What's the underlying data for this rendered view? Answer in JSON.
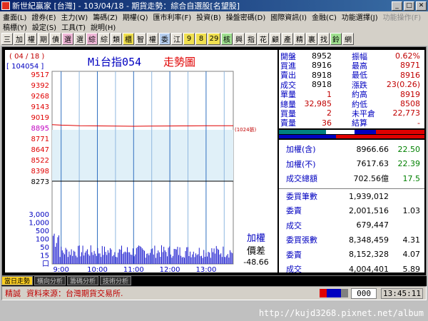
{
  "window": {
    "title": "新世紀贏家 [台灣] - 103/04/18 - 期貨走勢：綜合自選股[名望股]",
    "controls": [
      "_",
      "□",
      "✕"
    ]
  },
  "menu_row1": [
    "畫面(L)",
    "證券(E)",
    "主力(W)",
    "籌碼(Z)",
    "期權(Q)",
    "匯市利率(F)",
    "投資(B)",
    "操盤密碼(D)",
    "國際資訊(I)",
    "金融(C)",
    "功能選擇(J)"
  ],
  "menu_row1_disabled": [
    "功能操作(F)"
  ],
  "menu_row2": [
    "稿標(Y)",
    "設定(S)",
    "工具(T)",
    "說明(H)"
  ],
  "toolbar": [
    "三",
    "加",
    "權",
    "期",
    "債",
    "選",
    "選",
    "綜",
    "綜",
    "類",
    "櫃",
    "智",
    "權",
    "委",
    "江",
    "9",
    "8",
    "29",
    "核",
    "興",
    "指",
    "花",
    "顧",
    "產",
    "精",
    "裏",
    "找",
    "鈴",
    "網"
  ],
  "chart": {
    "date_label": "( 04 / 18 )",
    "code_label": "[ 104054 ]",
    "title_prefix": "Mi台指054",
    "title_suffix": "走勢圖",
    "price_ticks": [
      "9517",
      "9392",
      "9268",
      "9143",
      "9019",
      "8895",
      "8771",
      "8647",
      "8522",
      "8398",
      "8273"
    ],
    "volume_ticks": [
      "3,000",
      "1,000",
      "500",
      "100",
      "50",
      "15",
      "口"
    ],
    "time_ticks": [
      "9:00",
      "10:00",
      "11:00",
      "12:00",
      "13:00"
    ],
    "ref_label": "(1024張)",
    "side_label1": "加權",
    "side_label2": "價差",
    "side_value": "-48.66"
  },
  "chart_data": {
    "type": "line",
    "title": "Mi台指054 走勢圖",
    "ylim": [
      8273,
      9517
    ],
    "reference_price": 8895,
    "x_range": [
      "8:45",
      "13:45"
    ],
    "price_series": [
      {
        "t": "8:45",
        "v": 8930
      },
      {
        "t": "9:00",
        "v": 8925
      },
      {
        "t": "9:15",
        "v": 8922
      },
      {
        "t": "9:30",
        "v": 8918
      },
      {
        "t": "10:00",
        "v": 8916
      },
      {
        "t": "10:30",
        "v": 8914
      },
      {
        "t": "11:00",
        "v": 8912
      },
      {
        "t": "11:30",
        "v": 8913
      },
      {
        "t": "12:00",
        "v": 8915
      },
      {
        "t": "12:30",
        "v": 8916
      },
      {
        "t": "13:00",
        "v": 8917
      },
      {
        "t": "13:45",
        "v": 8918
      }
    ],
    "volume_note": "per-minute volume bars, mostly 100–500 口"
  },
  "quote": {
    "rows": [
      {
        "l1": "開盤",
        "v1": "8952",
        "l2": "振幅",
        "v2": "0.62%"
      },
      {
        "l1": "買進",
        "v1": "8916",
        "l2": "最高",
        "v2": "8971"
      },
      {
        "l1": "賣出",
        "v1": "8918",
        "l2": "最低",
        "v2": "8916"
      },
      {
        "l1": "成交",
        "v1": "8918",
        "l2": "漲跌",
        "v2": "23(0.26)"
      },
      {
        "l1": "單量",
        "v1": "1",
        "l2": "約高",
        "v2": "8919"
      },
      {
        "l1": "總量",
        "v1": "32,985",
        "l2": "約低",
        "v2": "8508"
      },
      {
        "l1": "買量",
        "v1": "2",
        "l2": "未平倉",
        "v2": "22,773"
      },
      {
        "l1": "賣量",
        "v1": "36",
        "l2": "結算",
        "v2": "-"
      }
    ]
  },
  "stats": [
    {
      "label": "加權(含)",
      "value": "8966.66",
      "value2": "22.50"
    },
    {
      "label": "加權(不)",
      "value": "7617.63",
      "value2": "22.39"
    },
    {
      "label": "成交總額",
      "value": "702.56億",
      "value2": "17.5"
    },
    {
      "label": "委買筆數",
      "value": "1,939,012",
      "value2": ""
    },
    {
      "label": "委賣",
      "value": "2,001,516",
      "value2": "1.03"
    },
    {
      "label": "成交",
      "value": "679,447",
      "value2": ""
    },
    {
      "label": "委買張數",
      "value": "8,348,459",
      "value2": "4.31"
    },
    {
      "label": "委賣",
      "value": "8,152,328",
      "value2": "4.07"
    },
    {
      "label": "成交",
      "value": "4,004,401",
      "value2": "5.89"
    }
  ],
  "tabs": [
    "當日走勢",
    "橫向分析",
    "籌碼分析",
    "技術分析"
  ],
  "status": {
    "tag": "精誠",
    "message": "資料來源：台灣期貨交易所.",
    "count": "000",
    "clock": "13:45:11"
  },
  "footer": {
    "url": "http://kujd3268.pixnet.net/album"
  }
}
